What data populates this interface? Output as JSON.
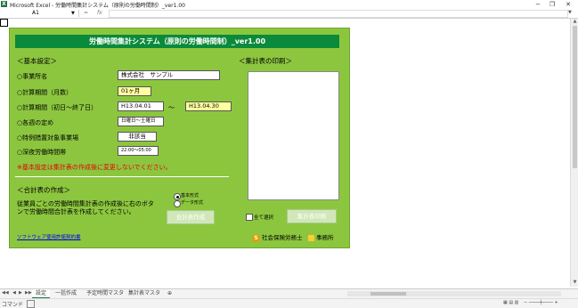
{
  "window": {
    "title": "Microsoft Excel - 労働時間集計システム（原則の労働時間制）_ver1.00",
    "app_icon": "X"
  },
  "window_controls": {
    "minimize": "−",
    "restore": "❐",
    "close": "✕"
  },
  "formula_bar": {
    "name_box": "A1",
    "fx_label": "fx",
    "value": ""
  },
  "panel": {
    "header": "労働時間集計システム（原則の労働時間制）_ver1.00",
    "basic": {
      "section_title": "＜基本設定＞",
      "office_label": "○事業所名",
      "office_value": "株式会社　サンプル",
      "months_label": "○計算期間（月数）",
      "months_value": "01ヶ月",
      "period_label": "○計算期間（初日～終了日）",
      "period_start": "H13.04.01",
      "period_sep": "～",
      "period_end": "H13.04.30",
      "week_label": "○各週の定め",
      "week_value": "日曜日～土曜日",
      "special_label": "○特例措置対象事業場",
      "special_value": "非該当",
      "night_label": "○深夜労働時間帯",
      "night_value": "22:00～05:00",
      "warning": "※基本設定は集計表の作成後に変更しないでください。"
    },
    "total": {
      "section_title": "＜合計表の作成＞",
      "description": "従業員ごとの労働時間集計表の作成後に右のボタンで労働時間合計表を作成してください。",
      "radio_basic": "基本形式",
      "radio_data": "データ形式",
      "create_button": "合計表作成"
    },
    "print": {
      "section_title": "＜集計表の印刷＞",
      "select_all": "全て選択",
      "print_button": "集計表印刷"
    },
    "footer": {
      "link": "ソフトウェア使用許諾契約書",
      "logo_sharoushi": "社会保険労務士",
      "logo_office": "事務所"
    }
  },
  "sheet_tabs": [
    "設定",
    "一括作成",
    "予定時間マスタ",
    "集計表マスタ"
  ],
  "status": {
    "mode": "コマンド"
  },
  "colors": {
    "panel": "#8cc63f",
    "header": "#0a8a3a",
    "warning": "#e60000"
  }
}
